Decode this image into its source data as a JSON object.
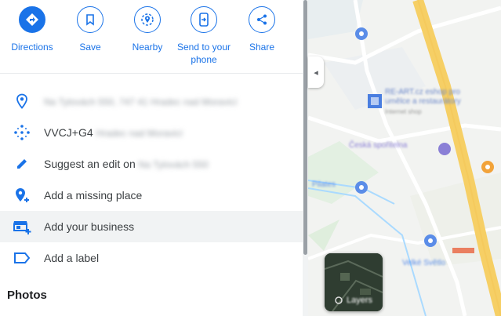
{
  "actions": [
    {
      "label": "Directions",
      "icon": "directions-icon"
    },
    {
      "label": "Save",
      "icon": "bookmark-icon"
    },
    {
      "label": "Nearby",
      "icon": "nearby-icon"
    },
    {
      "label": "Send to your phone",
      "icon": "phone-icon"
    },
    {
      "label": "Share",
      "icon": "share-icon"
    }
  ],
  "info": {
    "address": "Na Tylovách 550, 747 41 Hradec nad Moravicí",
    "plus_code_prefix": "VVCJ+G4",
    "plus_code_locality": "Hradec nad Moravicí",
    "suggest_edit_prefix": "Suggest an edit on",
    "suggest_edit_target": "Na Tylovách 550",
    "add_missing_place": "Add a missing place",
    "add_business": "Add your business",
    "add_label": "Add a label"
  },
  "photos_heading": "Photos",
  "map": {
    "collapse_glyph": "◂",
    "labels": [
      "RE-ART.cz eshop pro umělce a restaurátory",
      "Internet shop",
      "Česká spořitelna",
      "Pilates",
      "Velké Světlo"
    ],
    "layers_label": "Layers"
  },
  "colors": {
    "accent": "#1a73e8",
    "road": "#f6cf65",
    "water": "#aadaff"
  }
}
